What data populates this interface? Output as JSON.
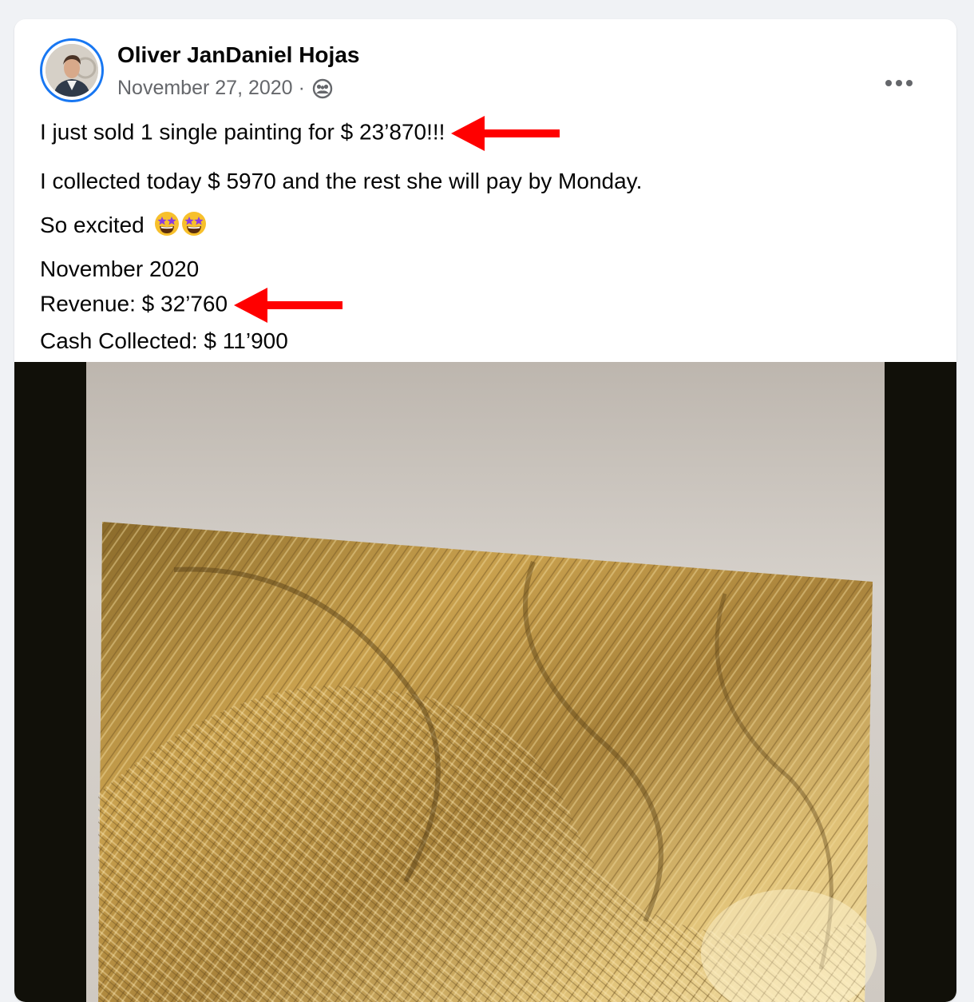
{
  "post": {
    "author": "Oliver JanDaniel Hojas",
    "date": "November 27, 2020",
    "separator": "·",
    "audience_icon": "friends-icon",
    "more_icon": "more-options-icon",
    "text": {
      "line1": "I just sold 1 single painting for $ 23’870!!!",
      "line2": "I collected today $ 5970 and the rest she will pay by Monday.",
      "line3": "So excited",
      "line3_emojis": [
        "star-struck-emoji",
        "star-struck-emoji"
      ],
      "line4": "November 2020",
      "line5": "Revenue: $ 32’760",
      "line6": "Cash Collected: $ 11’900"
    },
    "annotations": {
      "arrow_color": "#ff0000"
    },
    "photo": {
      "subject": "gold-textured-abstract-painting"
    }
  },
  "colors": {
    "accent": "#1877f2",
    "text_primary": "#050505",
    "text_secondary": "#65676b",
    "card_bg": "#ffffff",
    "page_bg": "#f0f2f5"
  }
}
